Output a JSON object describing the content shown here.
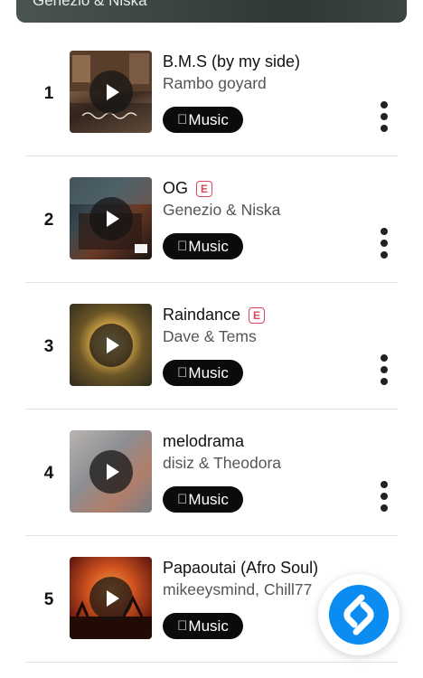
{
  "header_card": {
    "text": "Genezio & Niska"
  },
  "tracks": [
    {
      "rank": "1",
      "title": "B.M.S (by my side)",
      "artist": "Rambo goyard",
      "explicit": false,
      "badge": "Music"
    },
    {
      "rank": "2",
      "title": "OG",
      "artist": "Genezio & Niska",
      "explicit": true,
      "explicit_label": "E",
      "badge": "Music"
    },
    {
      "rank": "3",
      "title": "Raindance",
      "artist": "Dave & Tems",
      "explicit": true,
      "explicit_label": "E",
      "badge": "Music"
    },
    {
      "rank": "4",
      "title": "melodrama",
      "artist": "disiz & Theodora",
      "explicit": false,
      "badge": "Music"
    },
    {
      "rank": "5",
      "title": "Papaoutai (Afro Soul)",
      "artist": "mikeeysmind, Chill77",
      "explicit": false,
      "badge": "Music"
    }
  ],
  "colors": {
    "explicit": "#e0455a",
    "shazam_blue": "#0a8cf0",
    "badge_bg": "#0b0b0b"
  }
}
